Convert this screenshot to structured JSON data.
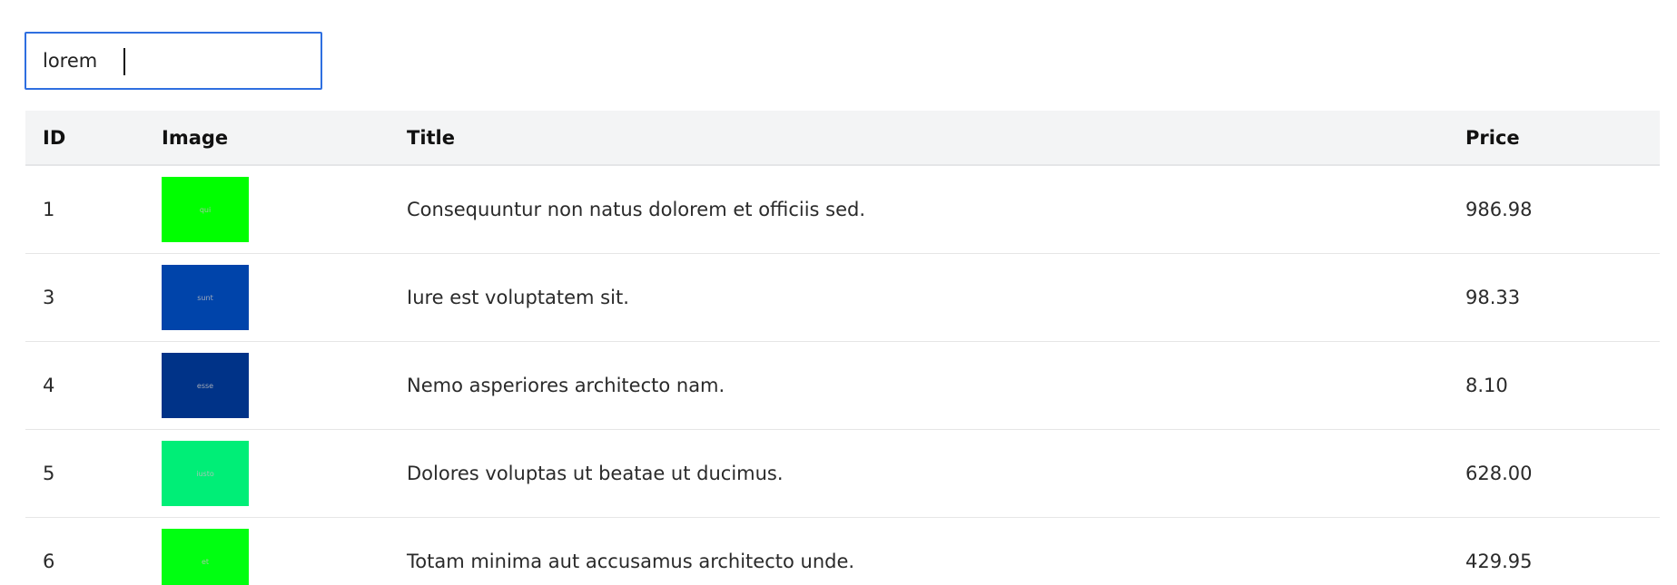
{
  "search": {
    "value": "lorem"
  },
  "table": {
    "headers": {
      "id": "ID",
      "image": "Image",
      "title": "Title",
      "price": "Price"
    },
    "rows": [
      {
        "id": "1",
        "image_text": "qui",
        "image_color": "#00ff00",
        "title": "Consequuntur non natus dolorem et officiis sed.",
        "price": "986.98"
      },
      {
        "id": "3",
        "image_text": "sunt",
        "image_color": "#0044aa",
        "title": "Iure est voluptatem sit.",
        "price": "98.33"
      },
      {
        "id": "4",
        "image_text": "esse",
        "image_color": "#003388",
        "title": "Nemo asperiores architecto nam.",
        "price": "8.10"
      },
      {
        "id": "5",
        "image_text": "iusto",
        "image_color": "#00ee77",
        "title": "Dolores voluptas ut beatae ut ducimus.",
        "price": "628.00"
      },
      {
        "id": "6",
        "image_text": "et",
        "image_color": "#00ff11",
        "title": "Totam minima aut accusamus architecto unde.",
        "price": "429.95"
      }
    ]
  }
}
